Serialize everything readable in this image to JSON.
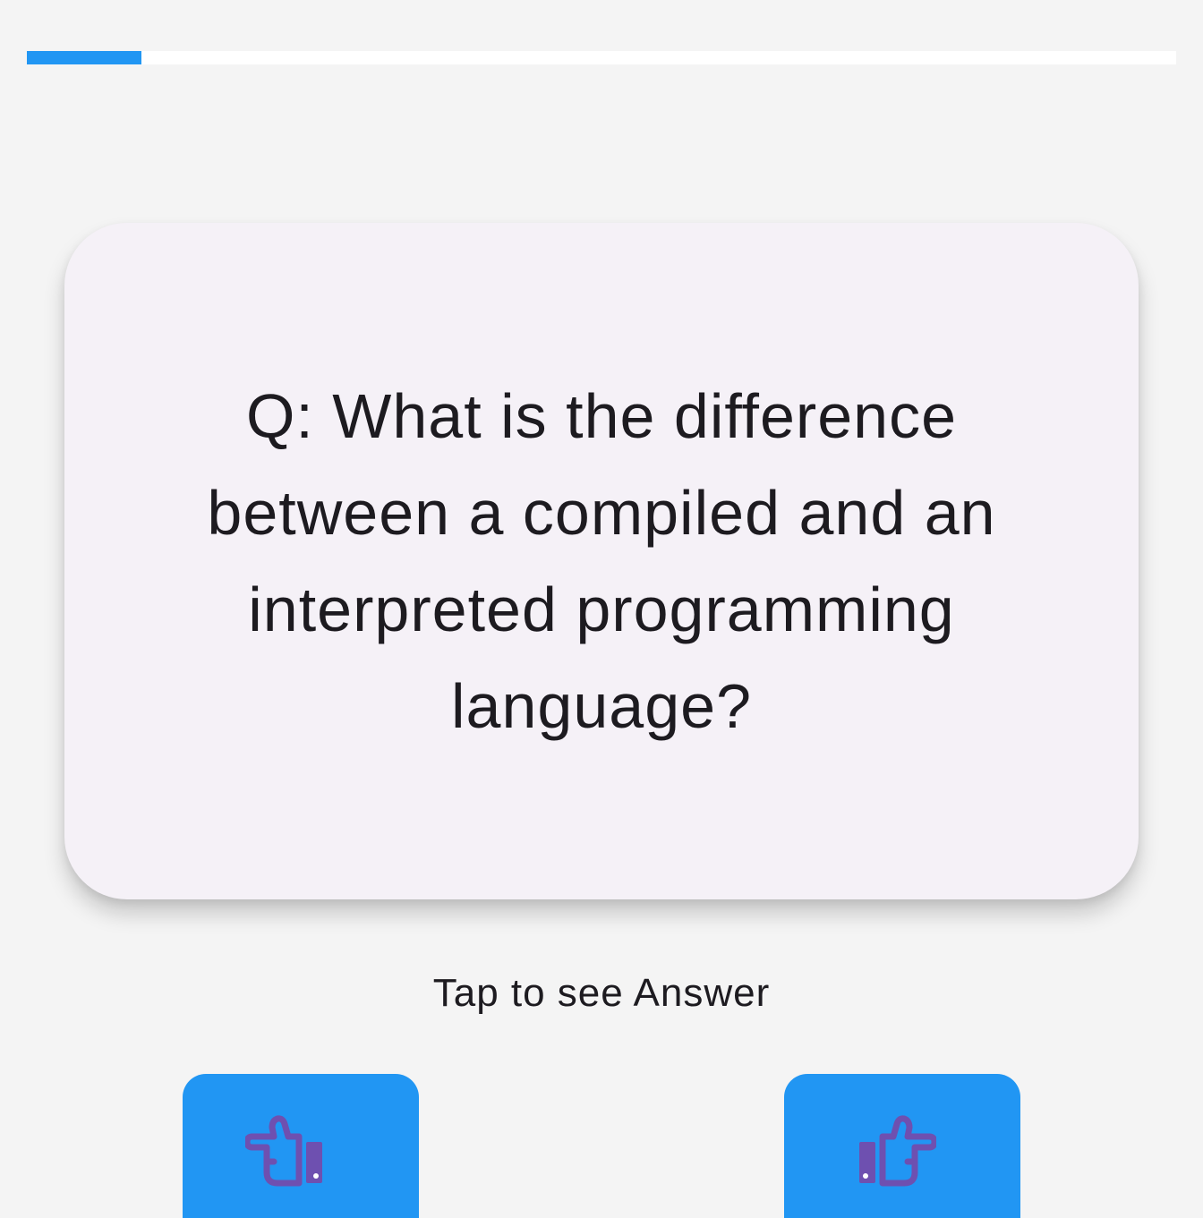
{
  "progress": {
    "value": 0.1,
    "track_color": "#ffffff",
    "fill_color": "#2196f3"
  },
  "card": {
    "question": "Q: What is the difference between a compiled and an interpreted programming language?"
  },
  "hint": "Tap to see Answer",
  "nav": {
    "prev_icon": "hand-point-left-icon",
    "next_icon": "hand-point-right-icon",
    "button_color": "#2196f3",
    "icon_color": "#6e50b0"
  }
}
